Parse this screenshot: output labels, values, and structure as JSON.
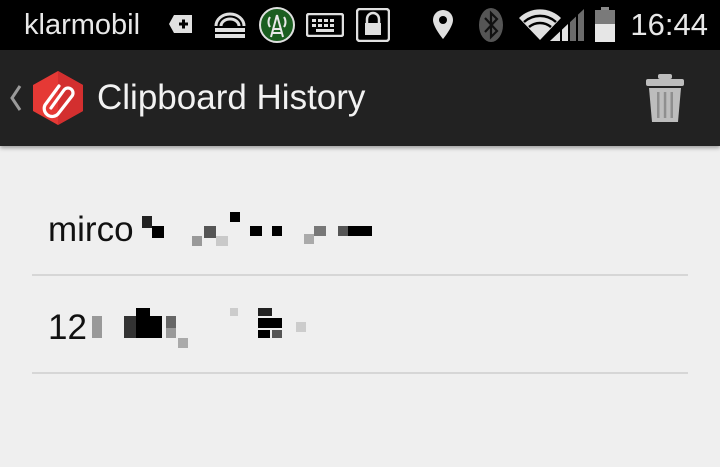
{
  "status_bar": {
    "carrier": "klarmobil",
    "time": "16:44",
    "icons": [
      "add-notification-icon",
      "cloud-sync-icon",
      "antenna-app-icon",
      "keyboard-icon",
      "lock-icon",
      "location-icon",
      "bluetooth-icon",
      "wifi-icon",
      "signal-icon",
      "battery-icon"
    ]
  },
  "action_bar": {
    "title": "Clipboard History",
    "up_icon": "chevron-left-icon",
    "logo_icon": "paperclip-icon",
    "action_icon": "trash-icon",
    "accent_color": "#e53935"
  },
  "clips": [
    {
      "text": "mirco"
    },
    {
      "text": "12"
    }
  ]
}
